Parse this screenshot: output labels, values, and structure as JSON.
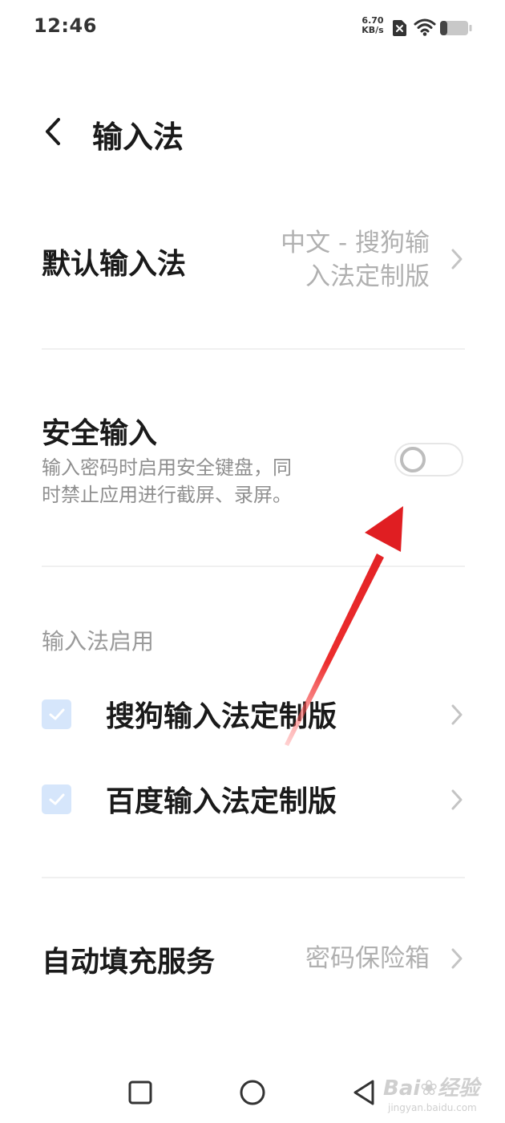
{
  "status_bar": {
    "time": "12:46",
    "net_speed_value": "6.70",
    "net_speed_unit": "KB/s",
    "icons": [
      "sim-disabled-icon",
      "wifi-icon",
      "battery-icon"
    ]
  },
  "header": {
    "title": "输入法",
    "back_icon": "chevron-left-icon"
  },
  "default_ime": {
    "label": "默认输入法",
    "value_line1": "中文 - 搜狗输",
    "value_line2": "入法定制版"
  },
  "secure_input": {
    "label": "安全输入",
    "desc_line1": "输入密码时启用安全键盘，同",
    "desc_line2": "时禁止应用进行截屏、录屏。",
    "enabled": false
  },
  "ime_section": {
    "label": "输入法启用",
    "items": [
      {
        "label": "搜狗输入法定制版",
        "checked": true
      },
      {
        "label": "百度输入法定制版",
        "checked": true
      }
    ]
  },
  "autofill": {
    "label": "自动填充服务",
    "value": "密码保险箱"
  },
  "nav_bar": {
    "icons": [
      "recents-square-icon",
      "home-circle-icon",
      "back-triangle-icon"
    ]
  },
  "colors": {
    "arrow": "#e8262a",
    "checkbox_fill": "#d6e6fb",
    "secondary_text": "#b0b0b0"
  }
}
